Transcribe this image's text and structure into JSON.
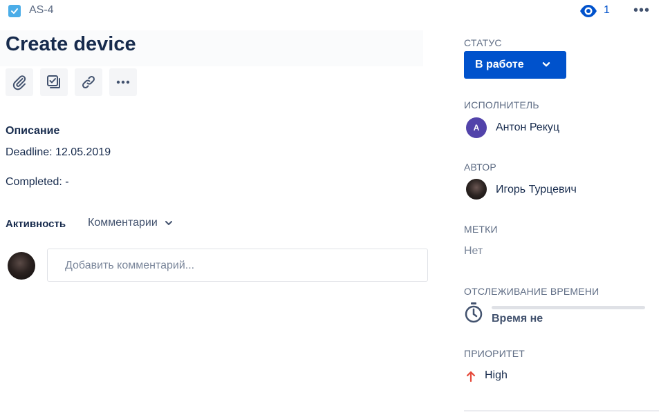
{
  "header": {
    "issue_key": "AS-4",
    "watch_count": "1"
  },
  "issue": {
    "title": "Create device"
  },
  "description": {
    "label": "Описание",
    "lines": [
      "Deadline: 12.05.2019",
      "Completed: -"
    ]
  },
  "activity": {
    "label": "Активность",
    "filter": "Комментарии",
    "comment_placeholder": "Добавить комментарий..."
  },
  "sidebar": {
    "status": {
      "label": "СТАТУС",
      "value": "В работе"
    },
    "assignee": {
      "label": "ИСПОЛНИТЕЛЬ",
      "initial": "A",
      "name": "Антон Рекуц"
    },
    "reporter": {
      "label": "АВТОР",
      "name": "Игорь Турцевич"
    },
    "labels": {
      "label": "МЕТКИ",
      "value": "Нет"
    },
    "time_tracking": {
      "label": "ОТСЛЕЖИВАНИЕ ВРЕМЕНИ",
      "value": "Время не",
      "progress": 0
    },
    "priority": {
      "label": "ПРИОРИТЕТ",
      "value": "High"
    }
  },
  "colors": {
    "primary": "#0052cc",
    "issue_type": "#4bade8",
    "assignee_avatar": "#5243aa",
    "priority_high": "#e5493a"
  },
  "icons": [
    "checkbox-icon",
    "eye-icon",
    "more-icon",
    "attachment-icon",
    "subtask-icon",
    "link-icon",
    "chevron-down-icon",
    "stopwatch-icon",
    "arrow-up-icon"
  ]
}
